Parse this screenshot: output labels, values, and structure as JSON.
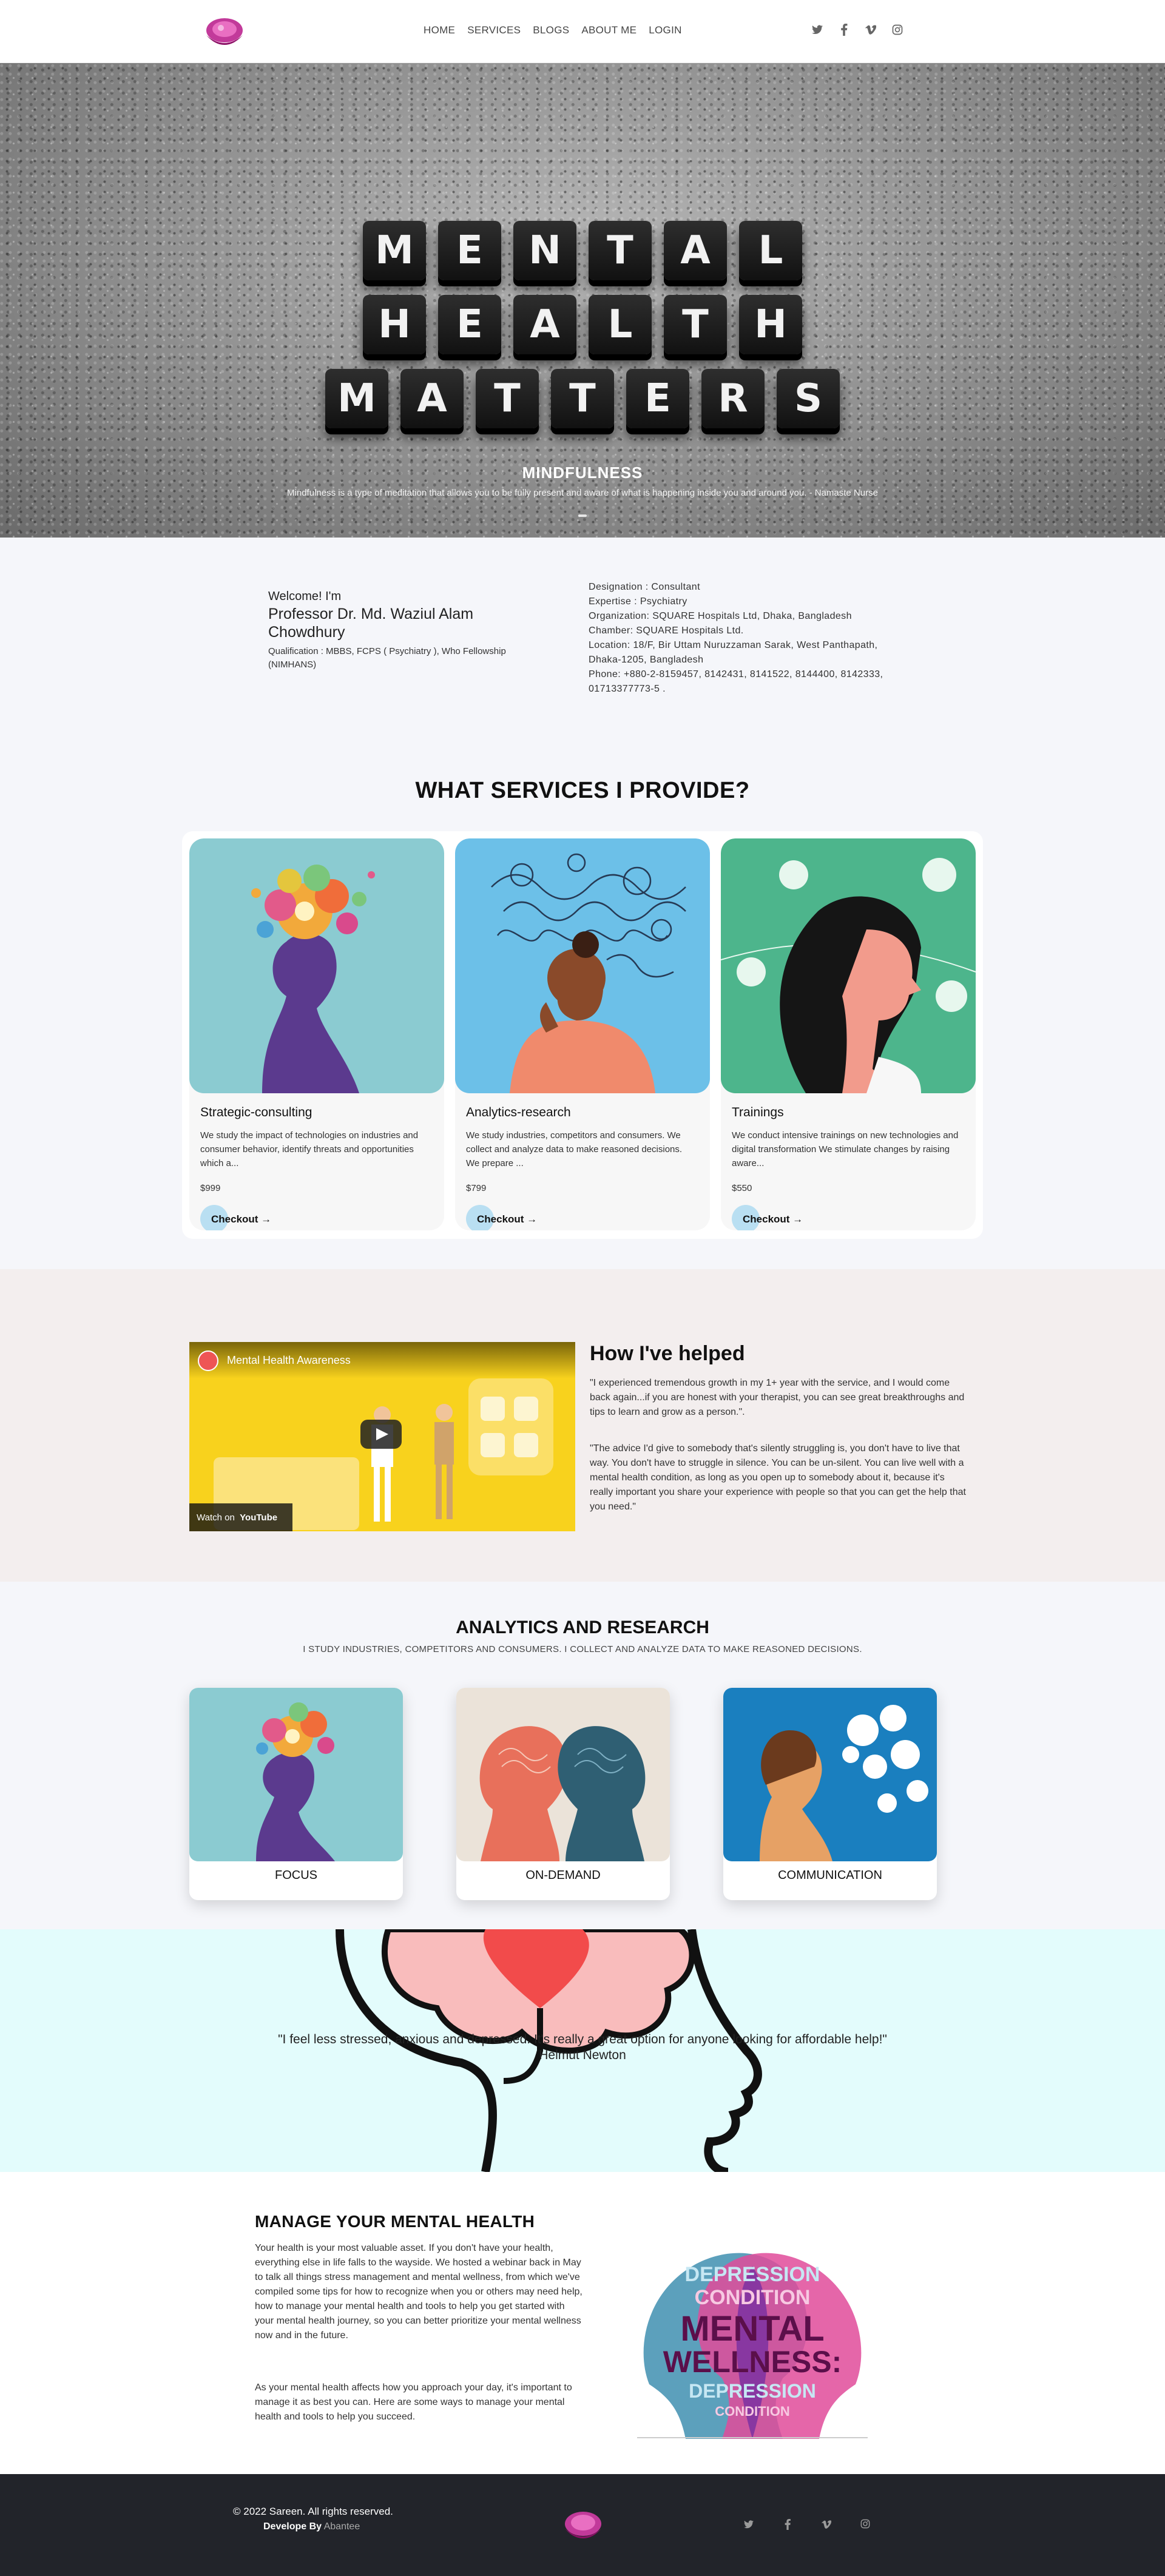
{
  "nav": {
    "links": [
      "HOME",
      "SERVICES",
      "BLOGS",
      "ABOUT ME",
      "LOGIN"
    ],
    "social_icons": [
      "twitter-icon",
      "facebook-icon",
      "vimeo-icon",
      "instagram-icon"
    ]
  },
  "hero": {
    "tiles": [
      [
        "M",
        "E",
        "N",
        "T",
        "A",
        "L"
      ],
      [
        "H",
        "E",
        "A",
        "L",
        "T",
        "H"
      ],
      [
        "M",
        "A",
        "T",
        "T",
        "E",
        "R",
        "S"
      ]
    ],
    "title": "MINDFULNESS",
    "subtitle": "Mindfulness is a type of meditation that allows you to be fully present and aware of what is happening inside you and around you. - Namaste Nurse"
  },
  "profile": {
    "welcome": "Welcome! I'm",
    "name": "Professor Dr. Md. Waziul Alam Chowdhury",
    "qualification": "Qualification : MBBS, FCPS ( Psychiatry ), Who Fellowship (NIMHANS)",
    "designation": "Designation : Consultant",
    "expertise": "Expertise : Psychiatry",
    "organization": "Organization: SQUARE Hospitals Ltd, Dhaka, Bangladesh",
    "chamber": "Chamber: SQUARE Hospitals Ltd.",
    "location": "Location: 18/F, Bir Uttam Nuruzzaman Sarak, West Panthapath, Dhaka-1205, Bangladesh",
    "phone": "Phone: +880-2-8159457, 8142431, 8141522, 8144400, 8142333, 01713377773-5 ."
  },
  "services": {
    "title": "WHAT SERVICES I PROVIDE?",
    "checkout_label": "Checkout →",
    "items": [
      {
        "title": "Strategic-consulting",
        "desc": "We study the impact of technologies on industries and consumer behavior, identify threats and opportunities which a...",
        "price": "$999"
      },
      {
        "title": "Analytics-research",
        "desc": "We study industries, competitors and consumers. We collect and analyze data to make reasoned decisions. We prepare ...",
        "price": "$799"
      },
      {
        "title": "Trainings",
        "desc": "We conduct intensive trainings on new technologies and digital transformation We stimulate changes by raising aware...",
        "price": "$550"
      }
    ]
  },
  "helped": {
    "title": "How I've helped",
    "video_title": "Mental Health Awareness",
    "watch_on": "Watch on",
    "youtube": "YouTube",
    "quote1": "\"I experienced tremendous growth in my 1+ year with the service, and I would come back again...if you are honest with your therapist, you can see great breakthroughs and tips to learn and grow as a person.\".",
    "quote2": "\"The advice I'd give to somebody that's silently struggling is, you don't have to live that way. You don't have to struggle in silence. You can be un-silent. You can live well with a mental health condition, as long as you open up to somebody about it, because it's really important you share your experience with people so that you can get the help that you need.\""
  },
  "analytics": {
    "title": "ANALYTICS AND RESEARCH",
    "subtitle": "I STUDY INDUSTRIES, COMPETITORS AND CONSUMERS. I COLLECT AND ANALYZE DATA TO MAKE REASONED DECISIONS.",
    "cards": [
      "FOCUS",
      "ON-DEMAND",
      "COMMUNICATION"
    ]
  },
  "quote": {
    "text": "\"I feel less stressed, anxious and depressed. It's really a great option for anyone looking for affordable help!\"",
    "author": "Helmut Newton"
  },
  "manage": {
    "title": "MANAGE YOUR MENTAL HEALTH",
    "p1": "Your health is your most valuable asset. If you don't have your health, everything else in life falls to the wayside. We hosted a webinar back in May to talk all things stress management and mental wellness, from which we've compiled some tips for how to recognize when you or others may need help, how to manage your mental health and tools to help you get started with your mental health journey, so you can better prioritize your mental wellness now and in the future.",
    "p2": "As your mental health affects how you approach your day, it's important to manage it as best you can. Here are some ways to manage your mental health and tools to help you succeed.",
    "poster_words": [
      "DEPRESSION",
      "CONDITION",
      "MENTAL",
      "WELLNESS:",
      "DEPRESSION",
      "CONDITION"
    ]
  },
  "footer": {
    "copyright": "© 2022 Sareen. All rights reserved.",
    "developed_by": "Develope By",
    "developer": "Abantee"
  },
  "colors": {
    "brand_magenta": "#a5157a",
    "checkout_circle": "#b9dff2",
    "footer_bg": "#22242a",
    "quote_bg": "#e3fcfc",
    "helped_bg": "#f3eeee"
  }
}
